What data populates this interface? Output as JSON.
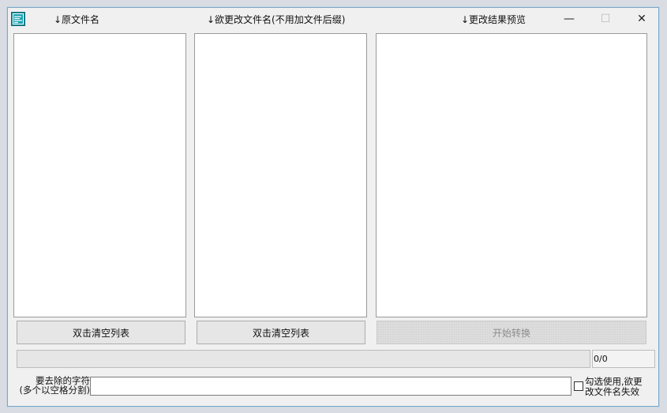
{
  "window": {
    "icon": "app-icon",
    "header_original": "↓原文件名",
    "header_new": "↓欲更改文件名(不用加文件后缀)",
    "header_preview": "↓更改结果预览",
    "minimize_glyph": "—",
    "maximize_glyph": "☐",
    "close_glyph": "✕"
  },
  "buttons": {
    "clear_original": "双击清空列表",
    "clear_new": "双击清空列表",
    "start": "开始转换"
  },
  "progress": {
    "value": 0,
    "max": 0,
    "counter_text": "0/0"
  },
  "remove_chars": {
    "label_line1": "要去除的字符",
    "label_line2": "(多个以空格分割)",
    "value": "",
    "placeholder": ""
  },
  "checkbox": {
    "checked": false,
    "label_line1": "勾选使用,欲更",
    "label_line2": "改文件名失效"
  }
}
